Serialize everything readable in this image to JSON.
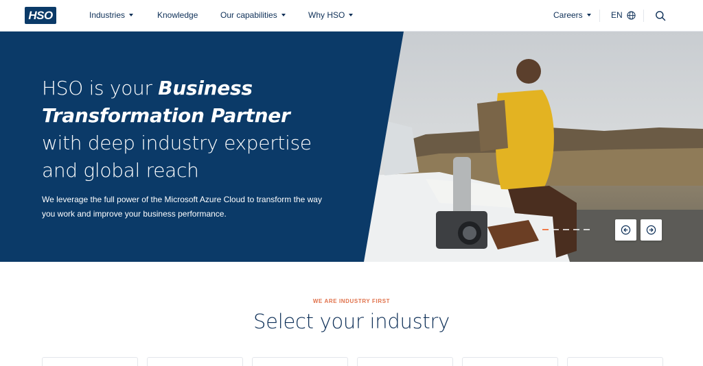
{
  "header": {
    "logo_text": "HSO",
    "nav": [
      {
        "label": "Industries",
        "has_dropdown": true
      },
      {
        "label": "Knowledge",
        "has_dropdown": false
      },
      {
        "label": "Our capabilities",
        "has_dropdown": true
      },
      {
        "label": "Why HSO",
        "has_dropdown": true
      }
    ],
    "careers_label": "Careers",
    "language_label": "EN",
    "search_icon": "search-icon",
    "globe_icon": "globe-icon"
  },
  "hero": {
    "title_part1": "HSO is your ",
    "title_bold": "Business Transformation Partner",
    "title_part2": " with deep industry expertise and global reach",
    "subtitle": "We leverage the full power of the Microsoft Azure Cloud to transform the way you work and improve your business performance.",
    "slides_total": 5,
    "active_slide": 1,
    "prev_icon": "arrow-left-icon",
    "next_icon": "arrow-right-icon"
  },
  "industries": {
    "eyebrow": "WE ARE INDUSTRY FIRST",
    "title": "Select your industry",
    "cards_count": 6
  },
  "colors": {
    "brand_navy": "#0b3a68",
    "accent_orange": "#e0714a",
    "text_navy": "#0d2f57"
  }
}
